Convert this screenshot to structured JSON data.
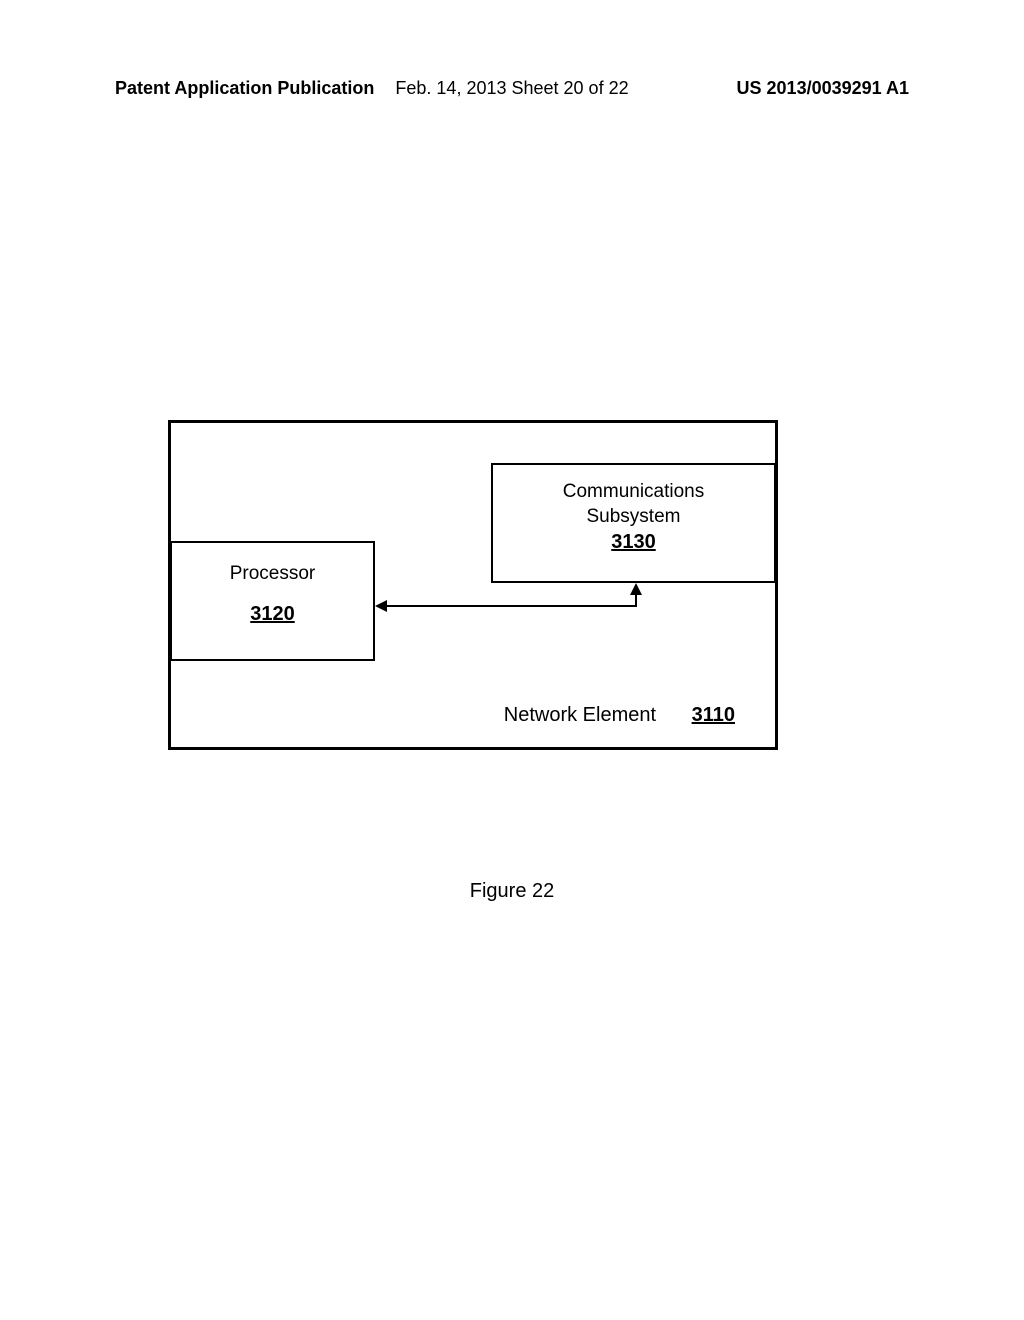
{
  "header": {
    "left": "Patent Application Publication",
    "center": "Feb. 14, 2013  Sheet 20 of 22",
    "right": "US 2013/0039291 A1"
  },
  "diagram": {
    "processor": {
      "label": "Processor",
      "ref": "3120"
    },
    "communications": {
      "line1": "Communications",
      "line2": "Subsystem",
      "ref": "3130"
    },
    "network_element": {
      "label": "Network Element",
      "ref": "3110"
    }
  },
  "figure_caption": "Figure 22"
}
